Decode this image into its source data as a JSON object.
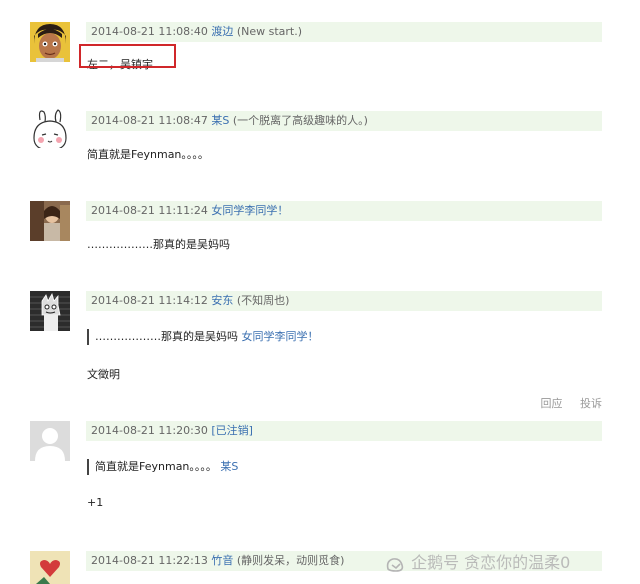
{
  "comments": [
    {
      "time": "2014-08-21 11:08:40",
      "user": "渡边",
      "signature": "(New start.)",
      "body": "左二，吴镇宇",
      "avatar": "cartoon-boy-avatar"
    },
    {
      "time": "2014-08-21 11:08:47",
      "user": "某S",
      "signature": "(一个脱离了高级趣味的人。)",
      "body": "简直就是Feynman。。。。",
      "avatar": "rabbit-doodle-avatar"
    },
    {
      "time": "2014-08-21 11:11:24",
      "user": "女同学李同学！",
      "signature": "",
      "body": "………………那真的是吴妈吗",
      "avatar": "photo-avatar"
    },
    {
      "time": "2014-08-21 11:14:12",
      "user": "安东",
      "signature": "(不知周也)",
      "quote_text": "………………那真的是吴妈吗",
      "quote_user": "女同学李同学！",
      "body": "文徵明",
      "reply_label": "回应",
      "report_label": "投诉",
      "avatar": "sketch-avatar"
    },
    {
      "time": "2014-08-21 11:20:30",
      "user": "[已注销]",
      "signature": "",
      "quote_text": "简直就是Feynman。。。。",
      "quote_user": "某S",
      "body": "+1",
      "avatar": "default-user-avatar"
    },
    {
      "time": "2014-08-21 11:22:13",
      "user": "竹音",
      "signature": "(静则发呆，动则觅食)",
      "avatar": "heart-avatar"
    }
  ],
  "watermark": "企鹅号 贪恋你的温柔0",
  "colors": {
    "meta_bg": "#eef7ea",
    "link": "#3a6fb0",
    "highlight": "#d0272a"
  }
}
